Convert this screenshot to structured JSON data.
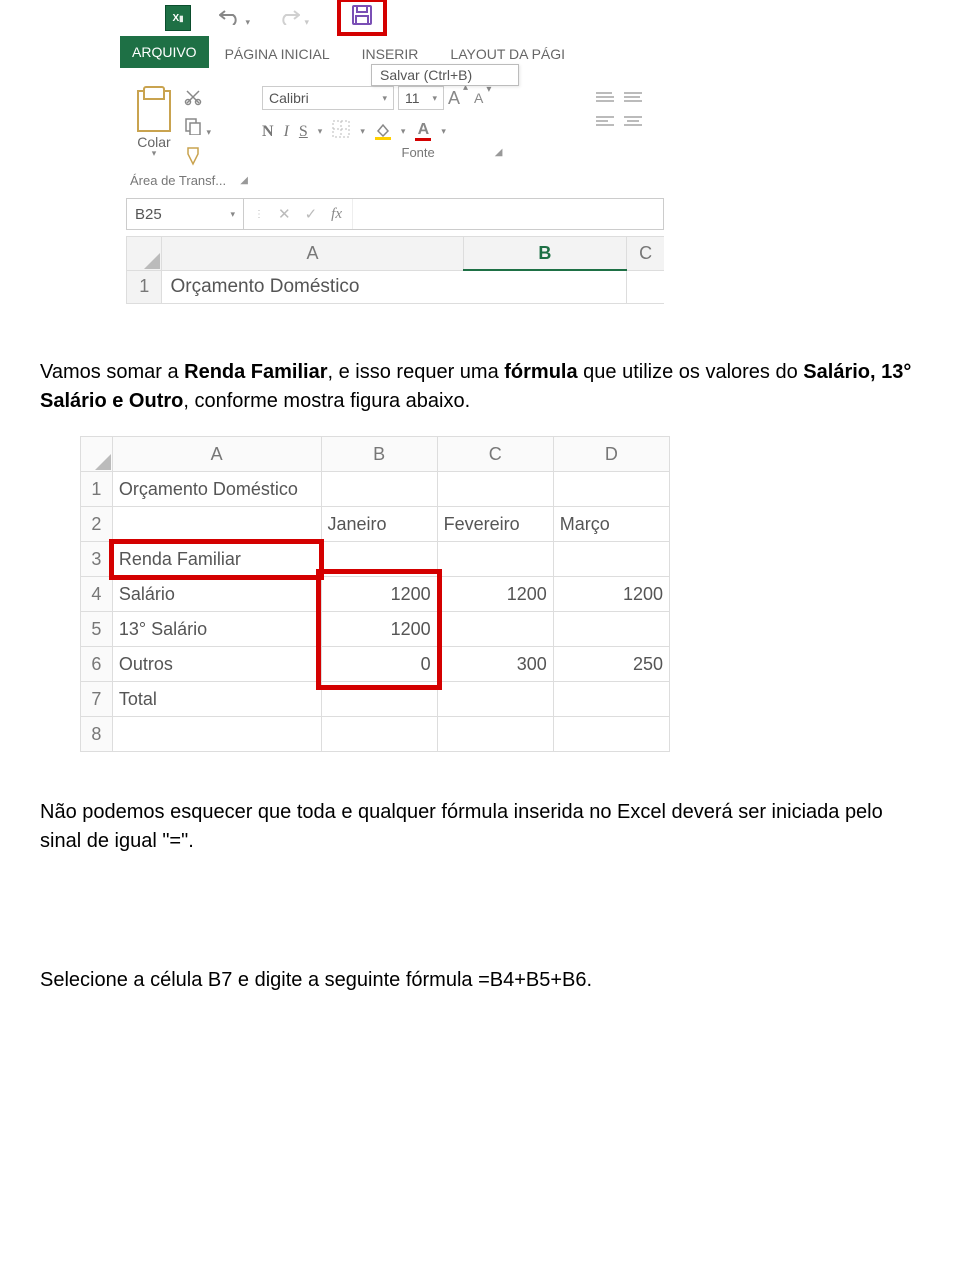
{
  "ribbon": {
    "qat": {
      "excel_icon": "X",
      "undo": "↶",
      "redo": "↷",
      "save": "💾"
    },
    "tabs": {
      "file": "ARQUIVO",
      "home": "PÁGINA INICIAL",
      "insert": "INSERIR",
      "layout": "LAYOUT DA PÁGI"
    },
    "tooltip": "Salvar (Ctrl+B)",
    "clipboard": {
      "paste_label": "Colar",
      "group_label": "Área de Transf..."
    },
    "font": {
      "name": "Calibri",
      "size": "11",
      "bold": "N",
      "italic": "I",
      "underline": "S",
      "grow": "A",
      "shrink": "A",
      "fill": "◇",
      "color_a": "A",
      "group_label": "Fonte"
    }
  },
  "formula_bar": {
    "name_box": "B25",
    "fx": "fx",
    "value": ""
  },
  "sheet1": {
    "col_a": "A",
    "col_b": "B",
    "col_c": "C",
    "row1": "1",
    "a1": "Orçamento Doméstico"
  },
  "text1_a": "Vamos somar a ",
  "text1_b": "Renda Familiar",
  "text1_c": ", e isso requer uma ",
  "text1_d": "fórmula",
  "text1_e": " que utilize os valores do ",
  "text1_f": "Salário, 13° Salário e Outro",
  "text1_g": ", conforme mostra figura abaixo.",
  "sheet2": {
    "cols": {
      "a": "A",
      "b": "B",
      "c": "C",
      "d": "D"
    },
    "rows": [
      "1",
      "2",
      "3",
      "4",
      "5",
      "6",
      "7",
      "8"
    ],
    "a1": "Orçamento Doméstico",
    "b2": "Janeiro",
    "c2": "Fevereiro",
    "d2": "Março",
    "a3": "Renda Familiar",
    "a4": "Salário",
    "b4": "1200",
    "c4": "1200",
    "d4": "1200",
    "a5": "13° Salário",
    "b5": "1200",
    "a6": "Outros",
    "b6": "0",
    "c6": "300",
    "d6": "250",
    "a7": "Total"
  },
  "text2_a": "Não podemos esquecer",
  "text2_b": " que toda e qualquer fórmula inserida no Excel deverá ser iniciada pelo sinal de ",
  "text2_c": "igual \"=\"",
  "text2_d": ".",
  "text3_a": "Selecione a ",
  "text3_b": "célula B7",
  "text3_c": " e digite a seguinte fórmula ",
  "text3_d": "=B4+B5+B6.",
  "icons": {
    "cut": "scissors",
    "copy": "copy",
    "paintfmt": "brush"
  }
}
